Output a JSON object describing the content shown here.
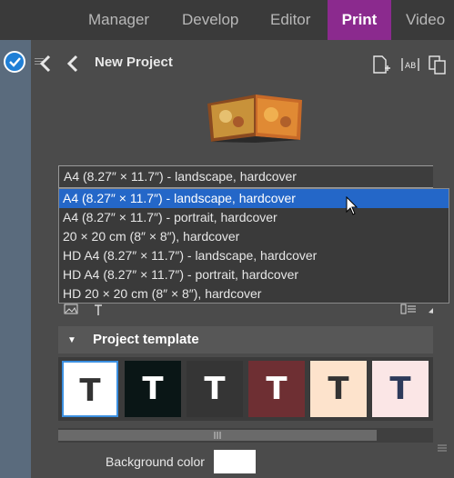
{
  "nav": {
    "tabs": [
      "Manager",
      "Develop",
      "Editor",
      "Print",
      "Video"
    ],
    "active_tab": "Print"
  },
  "header": {
    "title": "New Project",
    "icons": [
      "new-page-icon",
      "text-frame-icon",
      "duplicate-icon"
    ]
  },
  "format": {
    "selected": "A4 (8.27″ × 11.7″) - landscape, hardcover",
    "options": [
      "A4 (8.27″ × 11.7″) - landscape, hardcover",
      "A4 (8.27″ × 11.7″) - portrait, hardcover",
      "20 × 20 cm (8″ × 8″), hardcover",
      "HD A4 (8.27″ × 11.7″) - landscape, hardcover",
      "HD A4 (8.27″ × 11.7″) - portrait, hardcover",
      "HD 20 × 20 cm (8″ × 8″), hardcover"
    ]
  },
  "template_section": {
    "title": "Project template",
    "templates": [
      {
        "letter": "T",
        "bg": "#ffffff",
        "fg": "#333333"
      },
      {
        "letter": "T",
        "bg": "#0a1616",
        "fg": "#ffffff"
      },
      {
        "letter": "T",
        "bg": "#353535",
        "fg": "#ffffff"
      },
      {
        "letter": "T",
        "bg": "#6e2f33",
        "fg": "#ffffff"
      },
      {
        "letter": "T",
        "bg": "#fde3cc",
        "fg": "#333333"
      },
      {
        "letter": "T",
        "bg": "#fbe6e6",
        "fg": "#2d3a5a"
      }
    ]
  },
  "background": {
    "label": "Background color",
    "color": "#ffffff"
  },
  "colors": {
    "accent": "#8b2a8e",
    "selection": "#2467c8"
  }
}
